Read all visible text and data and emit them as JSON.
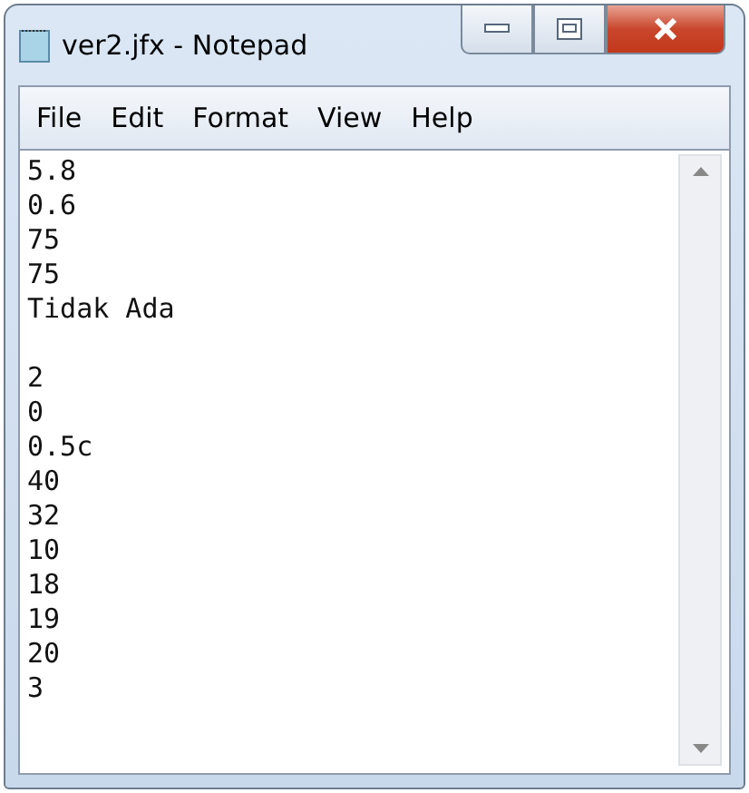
{
  "window": {
    "title": "ver2.jfx - Notepad"
  },
  "menu": [
    "File",
    "Edit",
    "Format",
    "View",
    "Help"
  ],
  "editor": {
    "text": "5.8\n0.6\n75\n75\nTidak Ada\n\n2\n0\n0.5c\n40\n32\n10\n18\n19\n20\n3"
  }
}
